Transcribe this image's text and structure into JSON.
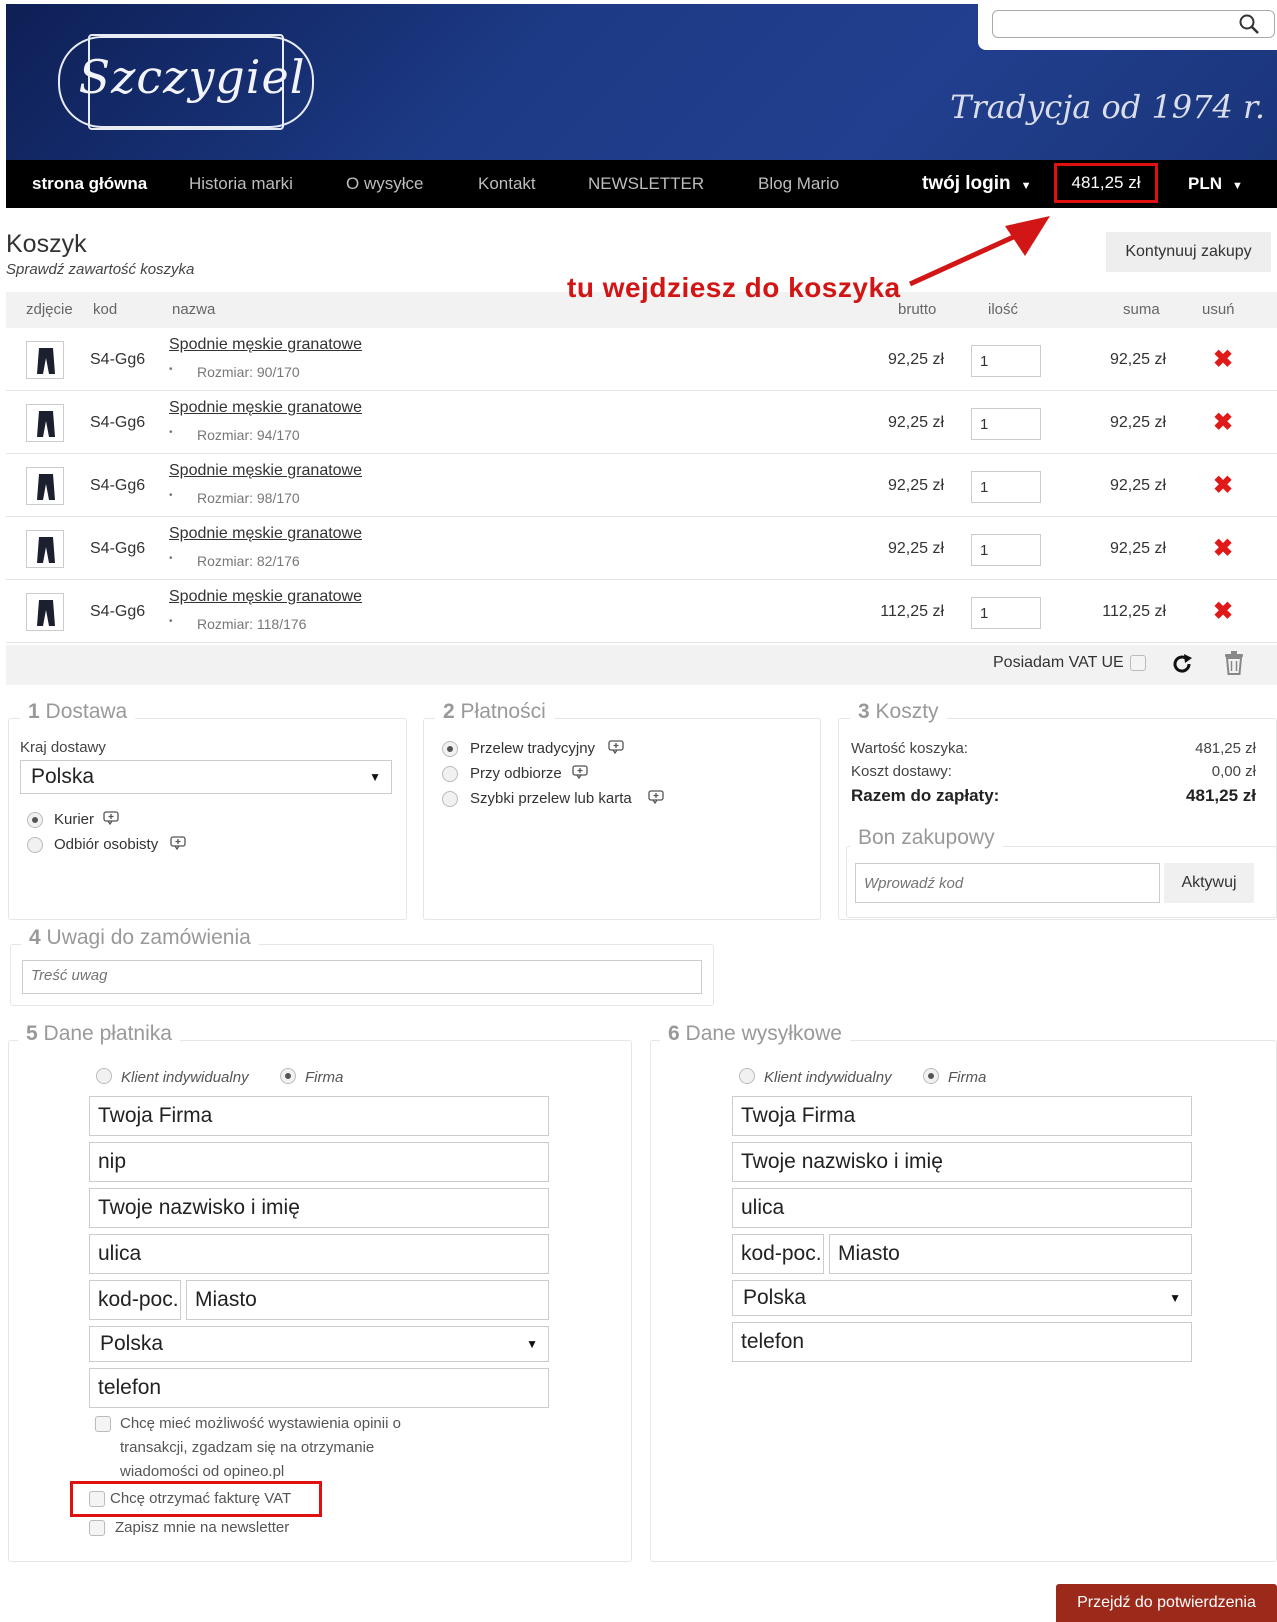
{
  "header": {
    "logo_text": "Szczygiel",
    "tagline": "Tradycja od 1974 r.",
    "search_placeholder": ""
  },
  "nav": {
    "items": [
      "strona główna",
      "Historia marki",
      "O wysyłce",
      "Kontakt",
      "NEWSLETTER",
      "Blog Mario"
    ],
    "login": "twój login",
    "cart_total": "481,25 zł",
    "currency": "PLN"
  },
  "cart": {
    "title": "Koszyk",
    "subtitle": "Sprawdź zawartość koszyka",
    "continue_label": "Kontynuuj zakupy",
    "annotation": "tu wejdziesz do koszyka",
    "columns": {
      "photo": "zdjęcie",
      "code": "kod",
      "name": "nazwa",
      "gross": "brutto",
      "qty": "ilość",
      "sum": "suma",
      "remove": "usuń"
    },
    "rows": [
      {
        "code": "S4-Gg6",
        "name": "Spodnie męskie granatowe",
        "size": "Rozmiar: 90/170",
        "price": "92,25 zł",
        "qty": "1",
        "sum": "92,25 zł"
      },
      {
        "code": "S4-Gg6",
        "name": "Spodnie męskie granatowe",
        "size": "Rozmiar: 94/170",
        "price": "92,25 zł",
        "qty": "1",
        "sum": "92,25 zł"
      },
      {
        "code": "S4-Gg6",
        "name": "Spodnie męskie granatowe",
        "size": "Rozmiar: 98/170",
        "price": "92,25 zł",
        "qty": "1",
        "sum": "92,25 zł"
      },
      {
        "code": "S4-Gg6",
        "name": "Spodnie męskie granatowe",
        "size": "Rozmiar: 82/176",
        "price": "92,25 zł",
        "qty": "1",
        "sum": "92,25 zł"
      },
      {
        "code": "S4-Gg6",
        "name": "Spodnie męskie granatowe",
        "size": "Rozmiar: 118/176",
        "price": "112,25 zł",
        "qty": "1",
        "sum": "112,25 zł"
      }
    ],
    "remove_glyph": "✖",
    "vat_ue_label": "Posiadam VAT UE"
  },
  "delivery": {
    "num": "1",
    "title": "Dostawa",
    "country_label": "Kraj dostawy",
    "country": "Polska",
    "options": [
      "Kurier",
      "Odbiór osobisty"
    ],
    "selected": 0
  },
  "payment": {
    "num": "2",
    "title": "Płatności",
    "options": [
      "Przelew tradycyjny",
      "Przy odbiorze",
      "Szybki przelew lub karta"
    ],
    "selected": 0
  },
  "costs": {
    "num": "3",
    "title": "Koszty",
    "cart_value_label": "Wartość koszyka:",
    "cart_value": "481,25 zł",
    "delivery_label": "Koszt dostawy:",
    "delivery": "0,00 zł",
    "total_label": "Razem do zapłaty:",
    "total": "481,25 zł",
    "voucher_title": "Bon zakupowy",
    "voucher_placeholder": "Wprowadź kod",
    "voucher_button": "Aktywuj"
  },
  "notes": {
    "num": "4",
    "title": "Uwagi do zamówienia",
    "placeholder": "Treść uwag"
  },
  "payer": {
    "num": "5",
    "title": "Dane płatnika",
    "type_individual": "Klient indywidualny",
    "type_company": "Firma",
    "company": "Twoja Firma",
    "nip": "nip",
    "name": "Twoje nazwisko i imię",
    "street": "ulica",
    "postcode": "kod-poc.",
    "city": "Miasto",
    "country": "Polska",
    "phone": "telefon",
    "opineo_consent": "Chcę mieć możliwość wystawienia opinii o transakcji, zgadzam się na otrzymanie wiadomości od opineo.pl",
    "vat_invoice": "Chcę otrzymać fakturę VAT",
    "newsletter": "Zapisz mnie na newsletter"
  },
  "shipping": {
    "num": "6",
    "title": "Dane wysyłkowe",
    "type_individual": "Klient indywidualny",
    "type_company": "Firma",
    "company": "Twoja Firma",
    "name": "Twoje nazwisko i imię",
    "street": "ulica",
    "postcode": "kod-poc.",
    "city": "Miasto",
    "country": "Polska",
    "phone": "telefon"
  },
  "submit_label": "Przejdź do potwierdzenia"
}
